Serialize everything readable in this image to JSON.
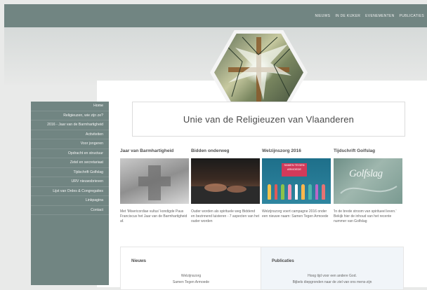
{
  "nav": {
    "items": [
      "NIEUWS",
      "IN DE KIJKER",
      "EVENEMENTEN",
      "PUBLICATIES"
    ]
  },
  "site": {
    "title": "Unie van de Religieuzen van Vlaanderen"
  },
  "sidebar": {
    "items": [
      {
        "label": "Home"
      },
      {
        "label": "Religieuzen, wie zijn ze?"
      },
      {
        "label": "2016 - Jaar van de Barmhartigheid"
      },
      {
        "label": "Activiteiten"
      },
      {
        "label": "Voor jongeren"
      },
      {
        "label": "Opdracht en structuur"
      },
      {
        "label": "Zetel en secretariaat"
      },
      {
        "label": "Tijdschrift Golfslag"
      },
      {
        "label": "URV nieuwsbrieven"
      },
      {
        "label": "Lijst van Ordes & Congregaties"
      },
      {
        "label": "Linkpagina"
      },
      {
        "label": "Contact"
      }
    ]
  },
  "features": [
    {
      "title": "Jaar van Barmhartigheid",
      "text": "Met 'Misericordiae vultus' kondigde Paus Franciscus het Jaar van de Barmhartigheid af."
    },
    {
      "title": "Bidden onderweg",
      "text": "Ouder worden als spirituele weg Biddend en bezinnend luisteren - 7 aspecten van het ouder worden"
    },
    {
      "title": "Welzijnszorg 2016",
      "text": "Welzijnszorg voert campagne 2016 onder een nieuwe naam: Samen Tegen Armoede",
      "badge": "SAMEN TEGEN ARMOEDE"
    },
    {
      "title": "Tijdschrift Golfslag",
      "text": "'In de brede stroom van spiritueel leven.' Bekijk hier de inhoud van het recente nummer van Golfslag",
      "logo": "Golfslag"
    }
  ],
  "news": {
    "heading": "Nieuws",
    "lines": [
      "Welzijnszorg",
      "Samen Tegen Armoede"
    ]
  },
  "publications": {
    "heading": "Publicaties",
    "lines": [
      "Hoog tijd voor een andere God.",
      "Bijbels diepgronden naar de ziel van ons mens-zijn"
    ]
  },
  "colors": {
    "topbar": "#718582",
    "sidebar": "#718582",
    "background": "#e9eae9"
  }
}
